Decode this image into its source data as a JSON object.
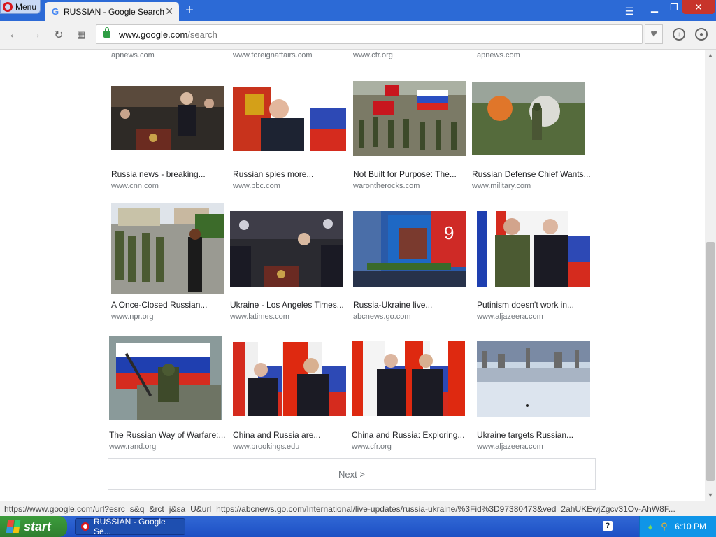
{
  "browser": {
    "menu_label": "Menu",
    "tab_title": "RUSSIAN - Google Search",
    "address_host": "www.google.com",
    "address_path": "/search",
    "new_tab_symbol": "+"
  },
  "top_sources": [
    "apnews.com",
    "www.foreignaffairs.com",
    "www.cfr.org",
    "apnews.com"
  ],
  "rows": [
    [
      {
        "title": "Russia news - breaking...",
        "source": "www.cnn.com"
      },
      {
        "title": "Russian spies more...",
        "source": "www.bbc.com"
      },
      {
        "title": "Not Built for Purpose: The...",
        "source": "warontherocks.com"
      },
      {
        "title": "Russian Defense Chief Wants...",
        "source": "www.military.com"
      }
    ],
    [
      {
        "title": "A Once-Closed Russian...",
        "source": "www.npr.org"
      },
      {
        "title": "Ukraine - Los Angeles Times...",
        "source": "www.latimes.com"
      },
      {
        "title": "Russia-Ukraine live...",
        "source": "abcnews.go.com"
      },
      {
        "title": "Putinism doesn't work in...",
        "source": "www.aljazeera.com"
      }
    ],
    [
      {
        "title": "The Russian Way of Warfare:...",
        "source": "www.rand.org"
      },
      {
        "title": "China and Russia are...",
        "source": "www.brookings.edu"
      },
      {
        "title": "China and Russia: Exploring...",
        "source": "www.cfr.org"
      },
      {
        "title": "Ukraine targets Russian...",
        "source": "www.aljazeera.com"
      }
    ]
  ],
  "next_label": "Next >",
  "status_url": "https://www.google.com/url?esrc=s&q=&rct=j&sa=U&url=https://abcnews.go.com/International/live-updates/russia-ukraine/%3Fid%3D97380473&ved=2ahUKEwjZgcv31Ov-AhW8F...",
  "taskbar": {
    "start_label": "start",
    "task_item_label": "RUSSIAN - Google Se...",
    "clock": "6:10 PM"
  },
  "colors": {
    "titlebar": "#2c6ad6",
    "taskbar": "#1d4fc4",
    "start": "#2f7f2f",
    "opera_red": "#d8171e"
  }
}
